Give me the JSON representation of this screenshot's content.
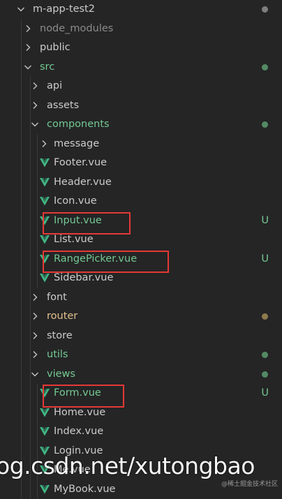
{
  "colors": {
    "background": "#252526",
    "text": "#cccccc",
    "dimmed": "#8b8b8b",
    "untracked": "#73c991",
    "modified": "#e2c08d",
    "vue": "#41b883",
    "highlight": "#e53935",
    "dot_untracked": "#538a64",
    "dot_modified": "#8d7a4d",
    "dot_neutral": "#7f7f7f"
  },
  "explorer": {
    "items": [
      {
        "label": "m-app-test2",
        "depth": 0,
        "kind": "folder",
        "open": true,
        "color": "text",
        "status": "dot",
        "dot_color": "dot_neutral"
      },
      {
        "label": "node_modules",
        "depth": 1,
        "kind": "folder",
        "open": false,
        "color": "dimmed"
      },
      {
        "label": "public",
        "depth": 1,
        "kind": "folder",
        "open": false,
        "color": "text"
      },
      {
        "label": "src",
        "depth": 1,
        "kind": "folder",
        "open": true,
        "color": "untracked",
        "status": "dot",
        "dot_color": "dot_untracked"
      },
      {
        "label": "api",
        "depth": 2,
        "kind": "folder",
        "open": false,
        "color": "text"
      },
      {
        "label": "assets",
        "depth": 2,
        "kind": "folder",
        "open": false,
        "color": "text"
      },
      {
        "label": "components",
        "depth": 2,
        "kind": "folder",
        "open": true,
        "color": "untracked",
        "status": "dot",
        "dot_color": "dot_untracked"
      },
      {
        "label": "message",
        "depth": 3,
        "kind": "folder",
        "open": false,
        "color": "text"
      },
      {
        "label": "Footer.vue",
        "depth": 3,
        "kind": "vue",
        "color": "text"
      },
      {
        "label": "Header.vue",
        "depth": 3,
        "kind": "vue",
        "color": "text"
      },
      {
        "label": "Icon.vue",
        "depth": 3,
        "kind": "vue",
        "color": "text"
      },
      {
        "label": "Input.vue",
        "depth": 3,
        "kind": "vue",
        "color": "untracked",
        "status": "U",
        "highlighted": true
      },
      {
        "label": "List.vue",
        "depth": 3,
        "kind": "vue",
        "color": "text"
      },
      {
        "label": "RangePicker.vue",
        "depth": 3,
        "kind": "vue",
        "color": "untracked",
        "status": "U",
        "highlighted": true
      },
      {
        "label": "Sidebar.vue",
        "depth": 3,
        "kind": "vue",
        "color": "text"
      },
      {
        "label": "font",
        "depth": 2,
        "kind": "folder",
        "open": false,
        "color": "text"
      },
      {
        "label": "router",
        "depth": 2,
        "kind": "folder",
        "open": false,
        "color": "modified",
        "status": "dot",
        "dot_color": "dot_modified"
      },
      {
        "label": "store",
        "depth": 2,
        "kind": "folder",
        "open": false,
        "color": "text"
      },
      {
        "label": "utils",
        "depth": 2,
        "kind": "folder",
        "open": false,
        "color": "untracked",
        "status": "dot",
        "dot_color": "dot_untracked"
      },
      {
        "label": "views",
        "depth": 2,
        "kind": "folder",
        "open": true,
        "color": "untracked",
        "status": "dot",
        "dot_color": "dot_untracked"
      },
      {
        "label": "Form.vue",
        "depth": 3,
        "kind": "vue",
        "color": "untracked",
        "status": "U",
        "highlighted": true
      },
      {
        "label": "Home.vue",
        "depth": 3,
        "kind": "vue",
        "color": "text"
      },
      {
        "label": "Index.vue",
        "depth": 3,
        "kind": "vue",
        "color": "text"
      },
      {
        "label": "Login.vue",
        "depth": 3,
        "kind": "vue",
        "color": "text"
      },
      {
        "label": "Me.vue",
        "depth": 3,
        "kind": "vue",
        "color": "text"
      },
      {
        "label": "MyBook.vue",
        "depth": 3,
        "kind": "vue",
        "color": "text"
      }
    ]
  },
  "watermark": {
    "text": "og.csdn.net/xutongbao",
    "corner": "@稀土掘金技术社区"
  }
}
